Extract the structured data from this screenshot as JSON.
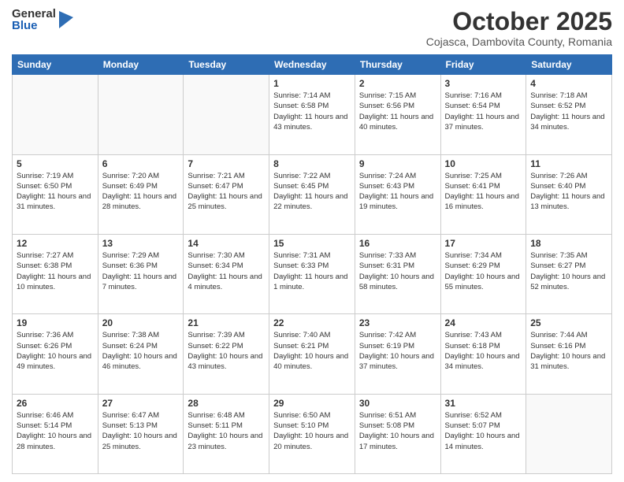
{
  "header": {
    "logo_general": "General",
    "logo_blue": "Blue",
    "month_title": "October 2025",
    "subtitle": "Cojasca, Dambovita County, Romania"
  },
  "days_of_week": [
    "Sunday",
    "Monday",
    "Tuesday",
    "Wednesday",
    "Thursday",
    "Friday",
    "Saturday"
  ],
  "weeks": [
    [
      {
        "day": "",
        "info": ""
      },
      {
        "day": "",
        "info": ""
      },
      {
        "day": "",
        "info": ""
      },
      {
        "day": "1",
        "info": "Sunrise: 7:14 AM\nSunset: 6:58 PM\nDaylight: 11 hours and 43 minutes."
      },
      {
        "day": "2",
        "info": "Sunrise: 7:15 AM\nSunset: 6:56 PM\nDaylight: 11 hours and 40 minutes."
      },
      {
        "day": "3",
        "info": "Sunrise: 7:16 AM\nSunset: 6:54 PM\nDaylight: 11 hours and 37 minutes."
      },
      {
        "day": "4",
        "info": "Sunrise: 7:18 AM\nSunset: 6:52 PM\nDaylight: 11 hours and 34 minutes."
      }
    ],
    [
      {
        "day": "5",
        "info": "Sunrise: 7:19 AM\nSunset: 6:50 PM\nDaylight: 11 hours and 31 minutes."
      },
      {
        "day": "6",
        "info": "Sunrise: 7:20 AM\nSunset: 6:49 PM\nDaylight: 11 hours and 28 minutes."
      },
      {
        "day": "7",
        "info": "Sunrise: 7:21 AM\nSunset: 6:47 PM\nDaylight: 11 hours and 25 minutes."
      },
      {
        "day": "8",
        "info": "Sunrise: 7:22 AM\nSunset: 6:45 PM\nDaylight: 11 hours and 22 minutes."
      },
      {
        "day": "9",
        "info": "Sunrise: 7:24 AM\nSunset: 6:43 PM\nDaylight: 11 hours and 19 minutes."
      },
      {
        "day": "10",
        "info": "Sunrise: 7:25 AM\nSunset: 6:41 PM\nDaylight: 11 hours and 16 minutes."
      },
      {
        "day": "11",
        "info": "Sunrise: 7:26 AM\nSunset: 6:40 PM\nDaylight: 11 hours and 13 minutes."
      }
    ],
    [
      {
        "day": "12",
        "info": "Sunrise: 7:27 AM\nSunset: 6:38 PM\nDaylight: 11 hours and 10 minutes."
      },
      {
        "day": "13",
        "info": "Sunrise: 7:29 AM\nSunset: 6:36 PM\nDaylight: 11 hours and 7 minutes."
      },
      {
        "day": "14",
        "info": "Sunrise: 7:30 AM\nSunset: 6:34 PM\nDaylight: 11 hours and 4 minutes."
      },
      {
        "day": "15",
        "info": "Sunrise: 7:31 AM\nSunset: 6:33 PM\nDaylight: 11 hours and 1 minute."
      },
      {
        "day": "16",
        "info": "Sunrise: 7:33 AM\nSunset: 6:31 PM\nDaylight: 10 hours and 58 minutes."
      },
      {
        "day": "17",
        "info": "Sunrise: 7:34 AM\nSunset: 6:29 PM\nDaylight: 10 hours and 55 minutes."
      },
      {
        "day": "18",
        "info": "Sunrise: 7:35 AM\nSunset: 6:27 PM\nDaylight: 10 hours and 52 minutes."
      }
    ],
    [
      {
        "day": "19",
        "info": "Sunrise: 7:36 AM\nSunset: 6:26 PM\nDaylight: 10 hours and 49 minutes."
      },
      {
        "day": "20",
        "info": "Sunrise: 7:38 AM\nSunset: 6:24 PM\nDaylight: 10 hours and 46 minutes."
      },
      {
        "day": "21",
        "info": "Sunrise: 7:39 AM\nSunset: 6:22 PM\nDaylight: 10 hours and 43 minutes."
      },
      {
        "day": "22",
        "info": "Sunrise: 7:40 AM\nSunset: 6:21 PM\nDaylight: 10 hours and 40 minutes."
      },
      {
        "day": "23",
        "info": "Sunrise: 7:42 AM\nSunset: 6:19 PM\nDaylight: 10 hours and 37 minutes."
      },
      {
        "day": "24",
        "info": "Sunrise: 7:43 AM\nSunset: 6:18 PM\nDaylight: 10 hours and 34 minutes."
      },
      {
        "day": "25",
        "info": "Sunrise: 7:44 AM\nSunset: 6:16 PM\nDaylight: 10 hours and 31 minutes."
      }
    ],
    [
      {
        "day": "26",
        "info": "Sunrise: 6:46 AM\nSunset: 5:14 PM\nDaylight: 10 hours and 28 minutes."
      },
      {
        "day": "27",
        "info": "Sunrise: 6:47 AM\nSunset: 5:13 PM\nDaylight: 10 hours and 25 minutes."
      },
      {
        "day": "28",
        "info": "Sunrise: 6:48 AM\nSunset: 5:11 PM\nDaylight: 10 hours and 23 minutes."
      },
      {
        "day": "29",
        "info": "Sunrise: 6:50 AM\nSunset: 5:10 PM\nDaylight: 10 hours and 20 minutes."
      },
      {
        "day": "30",
        "info": "Sunrise: 6:51 AM\nSunset: 5:08 PM\nDaylight: 10 hours and 17 minutes."
      },
      {
        "day": "31",
        "info": "Sunrise: 6:52 AM\nSunset: 5:07 PM\nDaylight: 10 hours and 14 minutes."
      },
      {
        "day": "",
        "info": ""
      }
    ]
  ]
}
